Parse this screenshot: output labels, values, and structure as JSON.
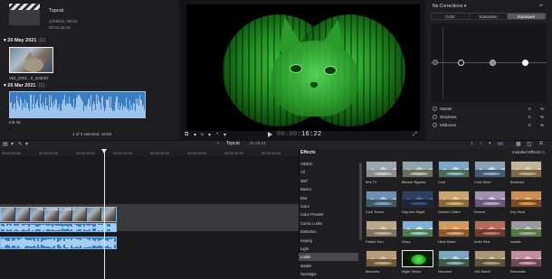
{
  "browser": {
    "event_title": "Topcat",
    "event_meta_1": "21/05/21, 09:22",
    "event_meta_2": "00:01:26:16",
    "sections": [
      {
        "date": "20 May 2021",
        "count": "(1)"
      },
      {
        "date": "26 Mar 2021",
        "count": "(1)"
      }
    ],
    "video_clip_name": "VID_2021...0_103037",
    "audio_clip_name": "Intr #2",
    "selection_status": "1 of 3 selected, 19:09"
  },
  "viewer": {
    "timecode_dim": "00:00:",
    "timecode": "16:22"
  },
  "inspector": {
    "title": "No Corrections ▾",
    "tabs": [
      {
        "label": "Color",
        "active": false
      },
      {
        "label": "Saturation",
        "active": false
      },
      {
        "label": "Exposure",
        "active": true
      }
    ],
    "sliders": [
      {
        "label": "Master",
        "value": "0",
        "unit": "%"
      },
      {
        "label": "Shadows",
        "value": "0",
        "unit": "%"
      },
      {
        "label": "Midtones",
        "value": "0",
        "unit": "%"
      }
    ]
  },
  "timeline": {
    "project": "Topcat",
    "duration": "21:26:15",
    "ruler": [
      "00:00:00:00",
      "00:00:05:00",
      "00:00:10:00",
      "00:00:15:00",
      "00:00:20:00",
      "00:00:25:00",
      "00:00:30:00",
      "00:00:35:00"
    ],
    "video_clip_name": "VID_20210520_103637",
    "playhead_position_label": ""
  },
  "effects": {
    "header": "Effects",
    "installed": "Installed Effects ◇",
    "categories": [
      {
        "label": "VIDEO",
        "selected": false
      },
      {
        "label": "All",
        "selected": false
      },
      {
        "label": "360°",
        "selected": false
      },
      {
        "label": "Basics",
        "selected": false
      },
      {
        "label": "Blur",
        "selected": false
      },
      {
        "label": "Color",
        "selected": false
      },
      {
        "label": "Color Presets",
        "selected": false
      },
      {
        "label": "Comic Looks",
        "selected": false
      },
      {
        "label": "Distortion",
        "selected": false
      },
      {
        "label": "Keying",
        "selected": false
      },
      {
        "label": "Light",
        "selected": false
      },
      {
        "label": "Looks",
        "selected": true
      },
      {
        "label": "Masks",
        "selected": false
      },
      {
        "label": "Nostalgia",
        "selected": false
      }
    ],
    "items": [
      {
        "name": "50s TV",
        "sky": "#9aa7ae",
        "mtn": "#cfd6da",
        "gnd": "#8d8d8d",
        "water": "#bfc7cc",
        "selected": false,
        "nv": false
      },
      {
        "name": "Bleach Bypass",
        "sky": "#8fa3ad",
        "mtn": "#c8d3d8",
        "gnd": "#6c6f55",
        "water": "#aebdc6",
        "selected": false,
        "nv": false
      },
      {
        "name": "Cool",
        "sky": "#7fa6c8",
        "mtn": "#cfe0ee",
        "gnd": "#4d6c58",
        "water": "#8fb6d8",
        "selected": false,
        "nv": false
      },
      {
        "name": "Cold Steel",
        "sky": "#8aa0b8",
        "mtn": "#d8e2ec",
        "gnd": "#445c70",
        "water": "#8ea6bf",
        "selected": false,
        "nv": false
      },
      {
        "name": "Bombed",
        "sky": "#c2b39a",
        "mtn": "#e2d7c3",
        "gnd": "#7a6a4a",
        "water": "#b9a88a",
        "selected": false,
        "nv": false
      },
      {
        "name": "Cool Tones",
        "sky": "#6f8fb1",
        "mtn": "#b9cde0",
        "gnd": "#3e5a64",
        "water": "#7fa0c0",
        "selected": false,
        "nv": false
      },
      {
        "name": "Day into Night",
        "sky": "#2e3f63",
        "mtn": "#5c6d8c",
        "gnd": "#1c2638",
        "water": "#3e5278",
        "selected": false,
        "nv": false
      },
      {
        "name": "Dessert Glare",
        "sky": "#c9a575",
        "mtn": "#ecd3a8",
        "gnd": "#8a6a3c",
        "water": "#d0ad78",
        "selected": false,
        "nv": false
      },
      {
        "name": "Dream",
        "sky": "#a28fb4",
        "mtn": "#e0d2e8",
        "gnd": "#6a5a74",
        "water": "#b9a4c6",
        "selected": false,
        "nv": false
      },
      {
        "name": "Dry Heat",
        "sky": "#c98f55",
        "mtn": "#ecc08c",
        "gnd": "#7a4c24",
        "water": "#cf9a5e",
        "selected": false,
        "nv": false
      },
      {
        "name": "Faded Sun",
        "sky": "#bba88c",
        "mtn": "#ddd0bb",
        "gnd": "#7c7360",
        "water": "#c2b398",
        "selected": false,
        "nv": false
      },
      {
        "name": "Glory",
        "sky": "#7fb0d8",
        "mtn": "#e6f0f6",
        "gnd": "#4f7a4a",
        "water": "#96c4e4",
        "selected": false,
        "nv": false
      },
      {
        "name": "Heat Wave",
        "sky": "#d49a5c",
        "mtn": "#f0c890",
        "gnd": "#8c5a2c",
        "water": "#dca36a",
        "selected": false,
        "nv": false
      },
      {
        "name": "Indie Red",
        "sky": "#b56a5c",
        "mtn": "#e0aa9c",
        "gnd": "#6c3a30",
        "water": "#c47a6a",
        "selected": false,
        "nv": false
      },
      {
        "name": "Isolate",
        "sky": "#9a9a9a",
        "mtn": "#d0d0d0",
        "gnd": "#4f7a3a",
        "water": "#a8a8a8",
        "selected": false,
        "nv": false
      },
      {
        "name": "Memoirs",
        "sky": "#b89c7a",
        "mtn": "#dac6a8",
        "gnd": "#6e5a3e",
        "water": "#bea482",
        "selected": false,
        "nv": false
      },
      {
        "name": "Night Vision",
        "sky": "#0b1f0b",
        "mtn": "#123a12",
        "gnd": "#081808",
        "water": "#0b1f0b",
        "selected": true,
        "nv": true
      },
      {
        "name": "Nonoem",
        "sky": "#7fa6c0",
        "mtn": "#d4e2ec",
        "gnd": "#3c5a44",
        "water": "#8fb2c8",
        "selected": false,
        "nv": false
      },
      {
        "name": "Old World",
        "sky": "#a89674",
        "mtn": "#d6c6a4",
        "gnd": "#5e5238",
        "water": "#b0a07e",
        "selected": false,
        "nv": false
      },
      {
        "name": "Romantic",
        "sky": "#c48ea0",
        "mtn": "#ecd0d8",
        "gnd": "#6a4a54",
        "water": "#d09eb0",
        "selected": false,
        "nv": false
      }
    ]
  }
}
